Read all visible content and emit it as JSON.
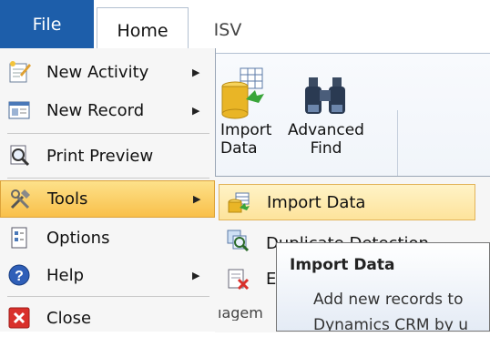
{
  "tabs": {
    "file": "File",
    "home": "Home",
    "isv": "ISV"
  },
  "ribbon": {
    "import_data": {
      "line1": "Import",
      "line2": "Data"
    },
    "advanced_find": {
      "line1": "Advanced",
      "line2": "Find"
    },
    "group_label_partial": "iagem"
  },
  "file_menu": {
    "items": [
      {
        "label": "New Activity",
        "icon": "new-activity-icon",
        "has_submenu": true
      },
      {
        "label": "New Record",
        "icon": "new-record-icon",
        "has_submenu": true
      },
      {
        "label": "Print Preview",
        "icon": "print-preview-icon",
        "has_submenu": false
      },
      {
        "label": "Tools",
        "icon": "tools-icon",
        "has_submenu": true
      },
      {
        "label": "Options",
        "icon": "options-icon",
        "has_submenu": false
      },
      {
        "label": "Help",
        "icon": "help-icon",
        "has_submenu": true
      },
      {
        "label": "Close",
        "icon": "close-icon",
        "has_submenu": false
      }
    ]
  },
  "tools_submenu": {
    "items": [
      {
        "label": "Import Data",
        "icon": "import-data-icon"
      },
      {
        "label": "Duplicate Detection",
        "icon": "duplicate-detection-icon"
      },
      {
        "label": "E",
        "icon": "bulk-delete-icon"
      }
    ]
  },
  "tooltip": {
    "title": "Import Data",
    "line1": "Add new records to",
    "line2": "Dynamics CRM by u"
  },
  "colors": {
    "file_tab": "#1d5eaa",
    "highlight": "#fde39b"
  }
}
